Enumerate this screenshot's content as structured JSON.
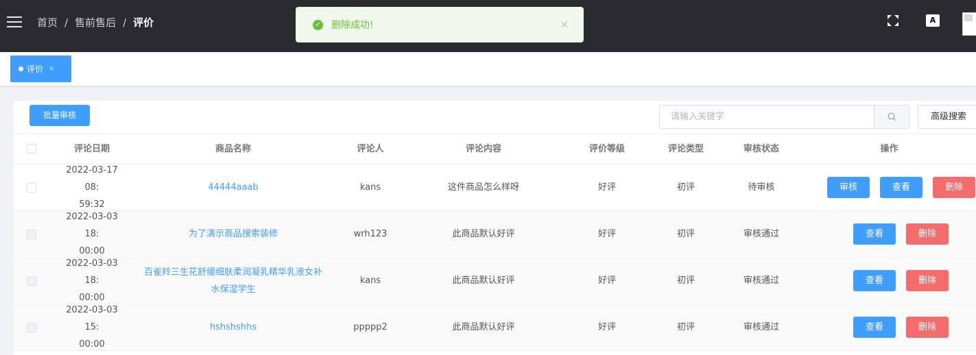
{
  "header": {
    "breadcrumb": [
      "首页",
      "售前售后",
      "评价"
    ],
    "breadcrumb_sep": "/",
    "translate_label": "A"
  },
  "toast": {
    "message": "删除成功!",
    "close": "×",
    "type": "success"
  },
  "tags": [
    {
      "label": "评价",
      "close": "×"
    }
  ],
  "toolbar": {
    "batch_label": "批量审核",
    "search_placeholder": "请输入关键字",
    "advanced_label": "高级搜索"
  },
  "table": {
    "columns": [
      "评论日期",
      "商品名称",
      "评论人",
      "评论内容",
      "评价等级",
      "评论类型",
      "审核状态",
      "操作"
    ],
    "rows": [
      {
        "date_line1": "2022-03-17 08:",
        "date_line2": "59:32",
        "product": "44444aaab",
        "product_line2": "",
        "user": "kans",
        "content": "这件商品怎么样呀",
        "level": "好评",
        "type": "初评",
        "status": "待审核",
        "actions": [
          "审核",
          "查看",
          "删除"
        ]
      },
      {
        "date_line1": "2022-03-03 18:",
        "date_line2": "00:00",
        "product": "为了演示商品搜索装修",
        "product_line2": "",
        "user": "wrh123",
        "content": "此商品默认好评",
        "level": "好评",
        "type": "初评",
        "status": "审核通过",
        "actions": [
          "查看",
          "删除"
        ]
      },
      {
        "date_line1": "2022-03-03 18:",
        "date_line2": "00:00",
        "product": "百雀羚三生花舒缓细肤柔润凝乳精华乳液女补",
        "product_line2": "水保湿学生",
        "user": "kans",
        "content": "此商品默认好评",
        "level": "好评",
        "type": "初评",
        "status": "审核通过",
        "actions": [
          "查看",
          "删除"
        ]
      },
      {
        "date_line1": "2022-03-03 15:",
        "date_line2": "00:00",
        "product": "hshshshhs",
        "product_line2": "",
        "user": "ppppp2",
        "content": "此商品默认好评",
        "level": "好评",
        "type": "初评",
        "status": "审核通过",
        "actions": [
          "查看",
          "删除"
        ]
      }
    ]
  },
  "colors": {
    "primary": "#409eff",
    "danger": "#f56c6c",
    "success": "#67c23a",
    "topbar": "#2b2b2f"
  }
}
